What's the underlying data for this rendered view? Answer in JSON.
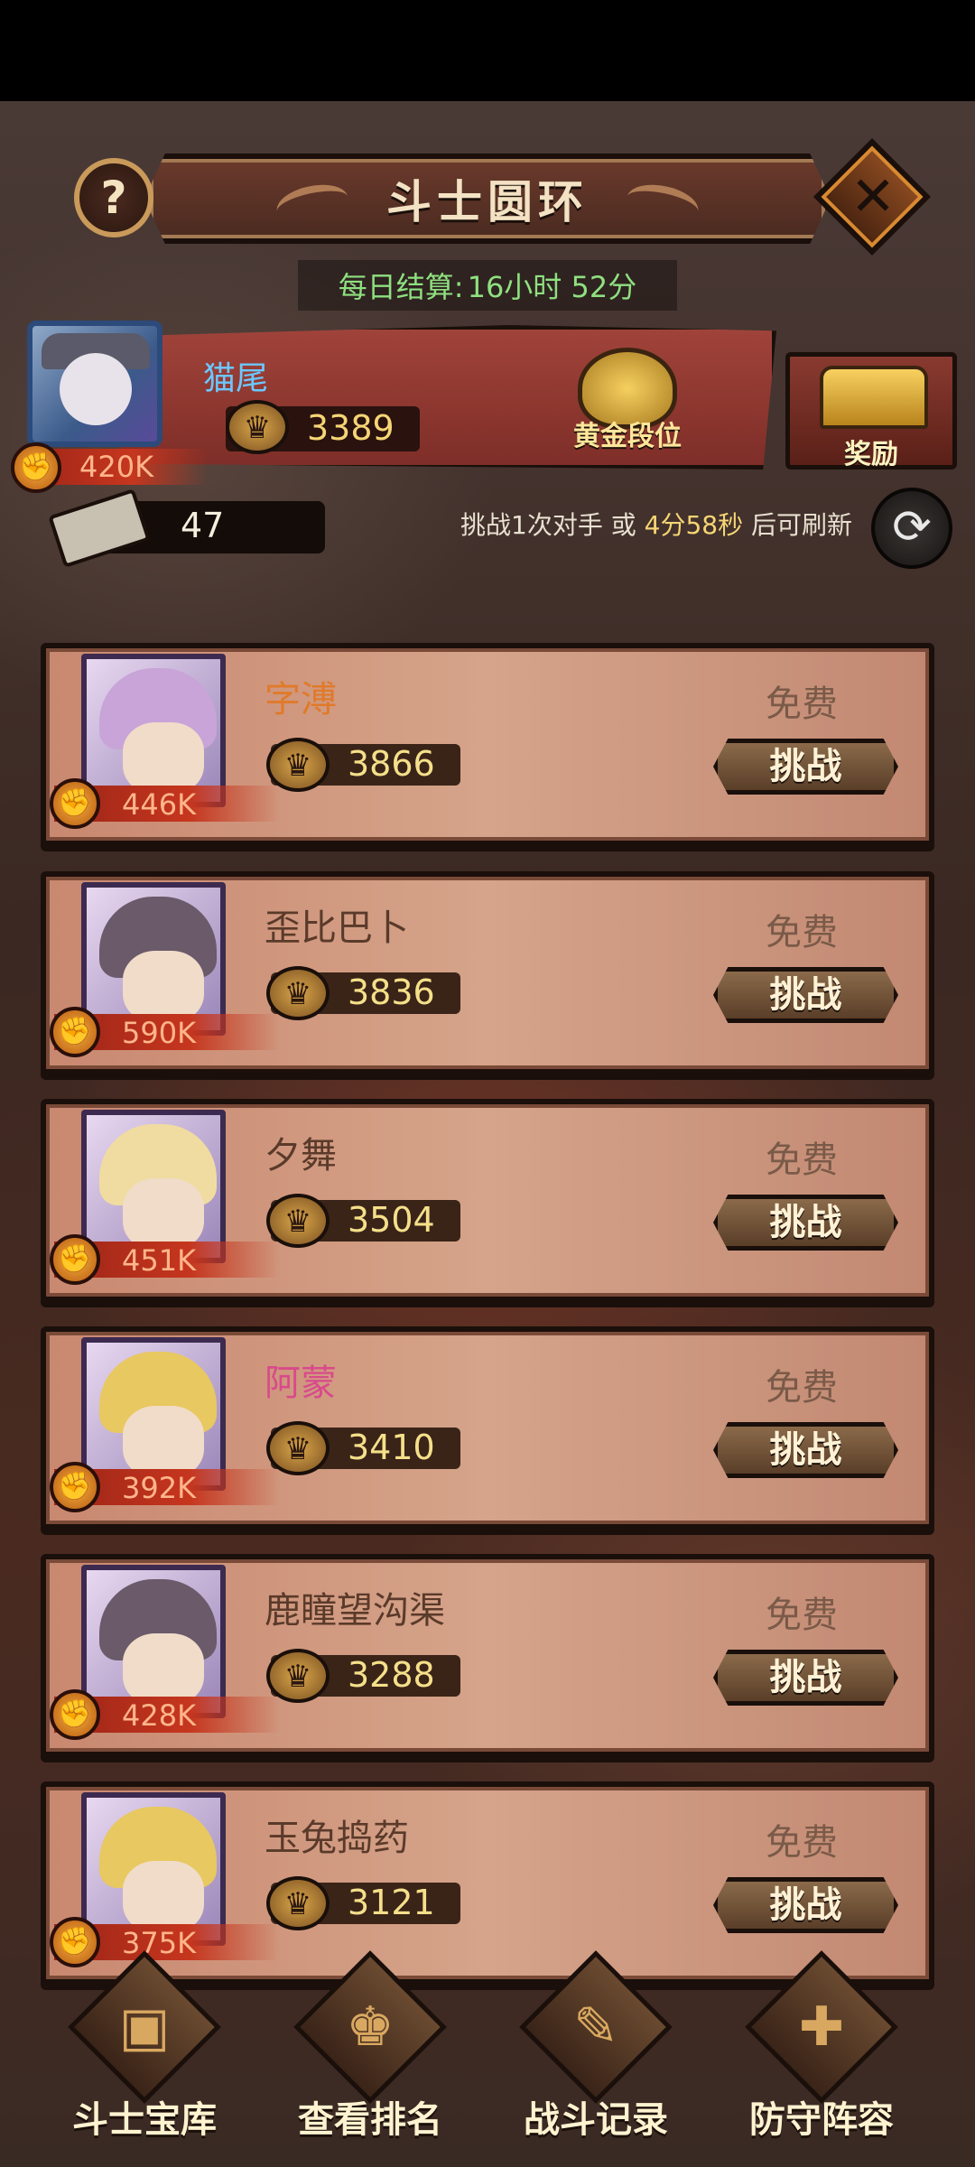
{
  "header": {
    "title": "斗士圆环",
    "help_label": "?",
    "close_label": "✕",
    "daily_label": "每日结算:",
    "daily_time": "16小时 52分"
  },
  "player": {
    "name": "猫尾",
    "score": "3389",
    "power": "420K",
    "rank_label": "黄金段位",
    "reward_label": "奖励",
    "tickets": "47"
  },
  "refresh": {
    "prefix": "挑战1次对手 或",
    "time": "4分58秒",
    "suffix": "后可刷新",
    "icon": "refresh-icon"
  },
  "opponents": [
    {
      "name": "字溥",
      "score": "3866",
      "power": "446K",
      "free": "免费",
      "action": "挑战",
      "name_color": "#e07a2a",
      "hair": "#c8a4d8"
    },
    {
      "name": "歪比巴卜",
      "score": "3836",
      "power": "590K",
      "free": "免费",
      "action": "挑战",
      "name_color": "#5a3a2a",
      "hair": "#6a5a6a"
    },
    {
      "name": "夕舞",
      "score": "3504",
      "power": "451K",
      "free": "免费",
      "action": "挑战",
      "name_color": "#5a3a2a",
      "hair": "#f0dca0"
    },
    {
      "name": "阿蒙",
      "score": "3410",
      "power": "392K",
      "free": "免费",
      "action": "挑战",
      "name_color": "#d94a8a",
      "hair": "#e8c860"
    },
    {
      "name": "鹿瞳望沟渠",
      "score": "3288",
      "power": "428K",
      "free": "免费",
      "action": "挑战",
      "name_color": "#5a3a2a",
      "hair": "#6a5a6a"
    },
    {
      "name": "玉兔捣药",
      "score": "3121",
      "power": "375K",
      "free": "免费",
      "action": "挑战",
      "name_color": "#5a3a2a",
      "hair": "#e8c860"
    }
  ],
  "nav": [
    {
      "label": "斗士宝库",
      "icon": "treasure-chest-icon",
      "glyph": "▣"
    },
    {
      "label": "查看排名",
      "icon": "trophy-cup-icon",
      "glyph": "♚"
    },
    {
      "label": "战斗记录",
      "icon": "scroll-icon",
      "glyph": "✎"
    },
    {
      "label": "防守阵容",
      "icon": "shield-icon",
      "glyph": "✚"
    }
  ]
}
